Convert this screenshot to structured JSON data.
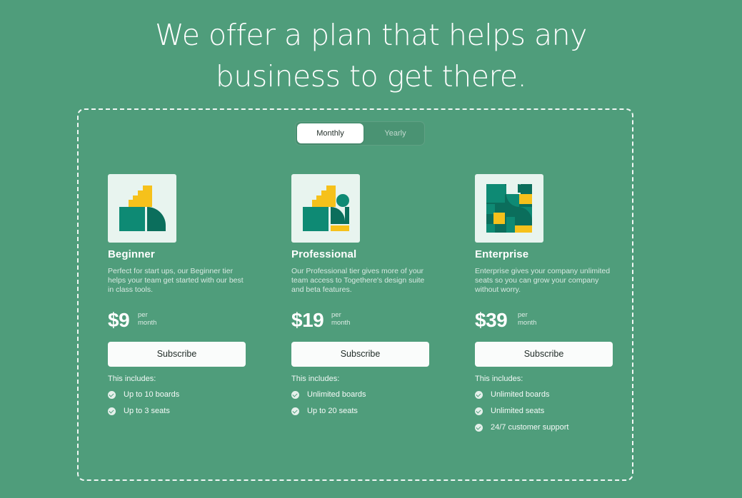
{
  "headline": {
    "line1": "We offer a plan that helps any",
    "line2": "business to get there."
  },
  "toggle": {
    "options": [
      "Monthly",
      "Yearly"
    ],
    "selected": "Monthly"
  },
  "plans": [
    {
      "name": "Beginner",
      "description": "Perfect for start ups, our Beginner tier helps your team get started with our best in class tools.",
      "price": "$9",
      "per_1": "per",
      "per_2": "month",
      "button": "Subscribe",
      "includes_title": "This includes:",
      "features": [
        "Up to 10 boards",
        "Up to 3 seats"
      ],
      "icon": "staircase-block-illustration"
    },
    {
      "name": "Professional",
      "description": "Our Professional tier gives more of your team access to Togethere's design suite and beta features.",
      "price": "$19",
      "per_1": "per",
      "per_2": "month",
      "button": "Subscribe",
      "includes_title": "This includes:",
      "features": [
        "Unlimited boards",
        "Up to 20 seats"
      ],
      "icon": "staircase-circle-illustration"
    },
    {
      "name": "Enterprise",
      "description": "Enterprise gives your company unlimited seats so you can grow your company without worry.",
      "price": "$39",
      "per_1": "per",
      "per_2": "month",
      "button": "Subscribe",
      "includes_title": "This includes:",
      "features": [
        "Unlimited boards",
        "Unlimited seats",
        "24/7 customer support"
      ],
      "icon": "geometric-grid-illustration"
    }
  ],
  "colors": {
    "background": "#4f9d7b",
    "teal": "#0e8a74",
    "dark_teal": "#0b6e5c",
    "yellow": "#f6c11b",
    "tile": "#e8f4ef"
  }
}
